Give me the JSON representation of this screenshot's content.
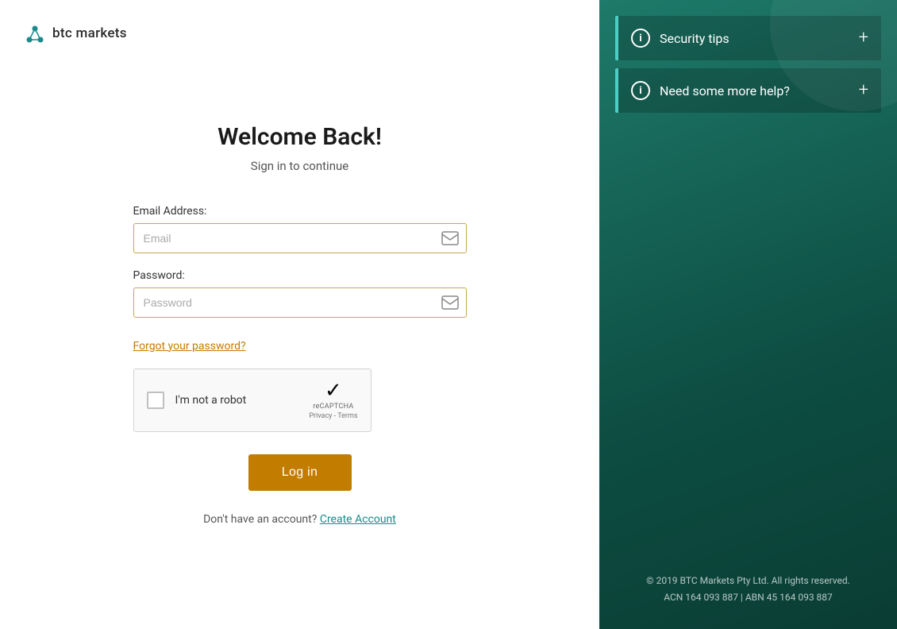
{
  "logo": {
    "text": "btc markets",
    "icon_color": "#1a8a8a"
  },
  "form": {
    "title": "Welcome Back!",
    "subtitle": "Sign in to continue",
    "email_label": "Email Address:",
    "email_placeholder": "Email",
    "password_label": "Password:",
    "password_placeholder": "Password",
    "forgot_password": "Forgot your password?",
    "recaptcha_label": "I'm not a robot",
    "recaptcha_brand": "reCAPTCHA",
    "recaptcha_links": "Privacy - Terms",
    "login_button": "Log in",
    "no_account_text": "Don't have an account?",
    "create_account_link": "Create Account"
  },
  "sidebar": {
    "security_tips_label": "Security tips",
    "help_label": "Need some more help?"
  },
  "footer": {
    "copyright": "© 2019 BTC Markets Pty Ltd. All rights reserved.",
    "acn": "ACN 164 093 887 | ABN 45 164 093 887"
  },
  "colors": {
    "accent_orange": "#c27c00",
    "accent_teal": "#1a8a8a",
    "panel_bg": "#1e7a6a",
    "border_left": "#4ecdc4"
  }
}
